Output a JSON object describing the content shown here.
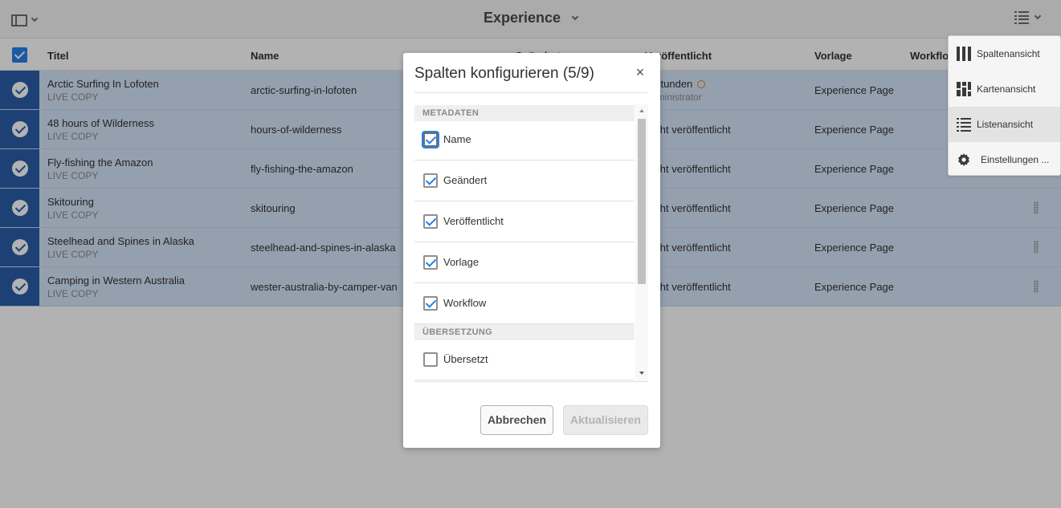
{
  "topbar": {
    "title": "Experience",
    "rail_icon": "rail-toggle-icon",
    "view_icon": "list-view-icon"
  },
  "table": {
    "headers": [
      "Titel",
      "Name",
      "Geändert",
      "Veröffentlicht",
      "Vorlage",
      "Workflow"
    ],
    "rows": [
      {
        "title": "Arctic Surfing In Lofoten",
        "status": "LIVE COPY",
        "name": "arctic-surfing-in-lofoten",
        "published": "2 Stunden",
        "published_by": "Administrator",
        "template": "Experience Page"
      },
      {
        "title": "48 hours of Wilderness",
        "status": "LIVE COPY",
        "name": "hours-of-wilderness",
        "published": "Nicht veröffentlicht",
        "template": "Experience Page"
      },
      {
        "title": "Fly-fishing the Amazon",
        "status": "LIVE COPY",
        "name": "fly-fishing-the-amazon",
        "published": "Nicht veröffentlicht",
        "template": "Experience Page"
      },
      {
        "title": "Skitouring",
        "status": "LIVE COPY",
        "name": "skitouring",
        "published": "Nicht veröffentlicht",
        "template": "Experience Page"
      },
      {
        "title": "Steelhead and Spines in Alaska",
        "status": "LIVE COPY",
        "name": "steelhead-and-spines-in-alaska",
        "published": "Nicht veröffentlicht",
        "template": "Experience Page"
      },
      {
        "title": "Camping in Western Australia",
        "status": "LIVE COPY",
        "name": "wester-australia-by-camper-van",
        "published": "Nicht veröffentlicht",
        "template": "Experience Page"
      }
    ]
  },
  "view_menu": {
    "items": [
      {
        "label": "Spaltenansicht",
        "icon": "column-view-icon"
      },
      {
        "label": "Kartenansicht",
        "icon": "card-view-icon"
      },
      {
        "label": "Listenansicht",
        "icon": "list-view-icon",
        "active": true
      },
      {
        "label": "Einstellungen ...",
        "icon": "gear-icon"
      }
    ]
  },
  "dialog": {
    "title": "Spalten konfigurieren (5/9)",
    "close": "×",
    "section_metadata": "METADATEN",
    "section_translation": "ÜBERSETZUNG",
    "options": [
      {
        "label": "Name",
        "checked": true
      },
      {
        "label": "Geändert",
        "checked": true
      },
      {
        "label": "Veröffentlicht",
        "checked": true
      },
      {
        "label": "Vorlage",
        "checked": true
      },
      {
        "label": "Workflow",
        "checked": true
      },
      {
        "label": "Übersetzt",
        "checked": false
      }
    ],
    "cancel_label": "Abbrechen",
    "update_label": "Aktualisieren"
  },
  "colors": {
    "accent": "#2680eb",
    "row_selected": "#d6e6f9",
    "thumb": "#2a5da8"
  }
}
